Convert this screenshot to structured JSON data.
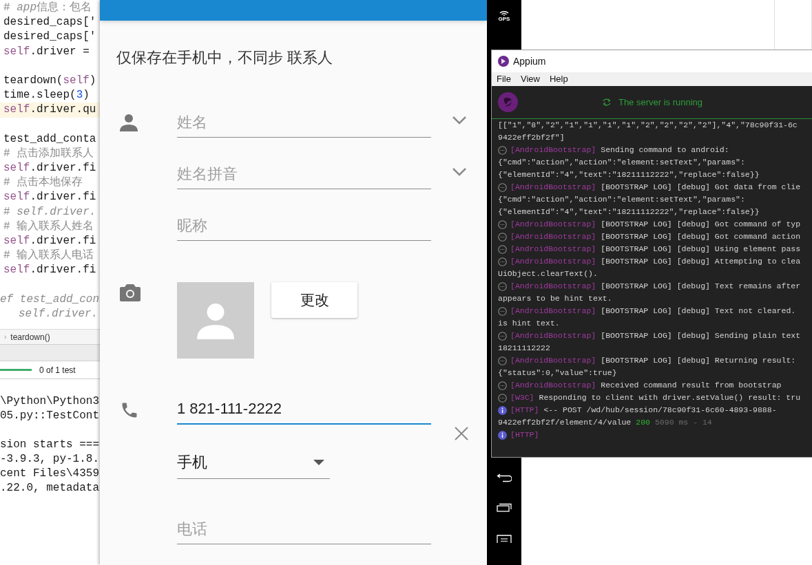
{
  "ide": {
    "code_lines": [
      {
        "kind": "code",
        "current": false,
        "segments": [
          {
            "kind": "comment",
            "text": "# "
          },
          {
            "kind": "comment_italic",
            "text": "app"
          },
          {
            "kind": "comment",
            "text": "信息：包名"
          }
        ]
      },
      {
        "kind": "code",
        "current": false,
        "segments": [
          {
            "kind": "plain",
            "text": "desired_caps['"
          }
        ]
      },
      {
        "kind": "code",
        "current": false,
        "segments": [
          {
            "kind": "plain",
            "text": "desired_caps['"
          }
        ]
      },
      {
        "kind": "code",
        "current": false,
        "segments": [
          {
            "kind": "self",
            "text": "self"
          },
          {
            "kind": "plain",
            "text": ".driver ="
          }
        ]
      },
      {
        "kind": "blank"
      },
      {
        "kind": "code",
        "current": false,
        "segments": [
          {
            "kind": "plain",
            "text": "teardown("
          },
          {
            "kind": "self",
            "text": "self"
          },
          {
            "kind": "plain",
            "text": ")"
          }
        ]
      },
      {
        "kind": "code",
        "current": false,
        "segments": [
          {
            "kind": "plain",
            "text": "time.sleep("
          },
          {
            "kind": "number",
            "text": "3"
          },
          {
            "kind": "plain",
            "text": ")"
          }
        ]
      },
      {
        "kind": "code",
        "current": true,
        "segments": [
          {
            "kind": "self",
            "text": "self"
          },
          {
            "kind": "plain",
            "text": ".driver.qu"
          }
        ]
      },
      {
        "kind": "blank"
      },
      {
        "kind": "code",
        "current": false,
        "segments": [
          {
            "kind": "plain",
            "text": "test_add_conta"
          }
        ]
      },
      {
        "kind": "code",
        "current": false,
        "segments": [
          {
            "kind": "comment",
            "text": "# 点击添加联系人"
          }
        ]
      },
      {
        "kind": "code",
        "current": false,
        "segments": [
          {
            "kind": "self",
            "text": "self"
          },
          {
            "kind": "plain",
            "text": ".driver.fi"
          }
        ]
      },
      {
        "kind": "code",
        "current": false,
        "segments": [
          {
            "kind": "comment",
            "text": "# 点击本地保存"
          }
        ]
      },
      {
        "kind": "code",
        "current": false,
        "segments": [
          {
            "kind": "self",
            "text": "self"
          },
          {
            "kind": "plain",
            "text": ".driver.fi"
          }
        ]
      },
      {
        "kind": "code",
        "current": false,
        "segments": [
          {
            "kind": "comment",
            "text": "# "
          },
          {
            "kind": "comment_italic",
            "text": "self.driver."
          }
        ]
      },
      {
        "kind": "code",
        "current": false,
        "segments": [
          {
            "kind": "comment",
            "text": "# 输入联系人姓名"
          }
        ]
      },
      {
        "kind": "code",
        "current": false,
        "segments": [
          {
            "kind": "self",
            "text": "self"
          },
          {
            "kind": "plain",
            "text": ".driver.fi"
          }
        ]
      },
      {
        "kind": "code",
        "current": false,
        "segments": [
          {
            "kind": "comment",
            "text": "# 输入联系人电话"
          }
        ]
      },
      {
        "kind": "code",
        "current": false,
        "segments": [
          {
            "kind": "self",
            "text": "self"
          },
          {
            "kind": "plain",
            "text": ".driver.fi"
          }
        ]
      },
      {
        "kind": "blank"
      },
      {
        "kind": "edge_code",
        "current": false,
        "segments": [
          {
            "kind": "comment_italic",
            "text": "ef test_add_con"
          }
        ]
      },
      {
        "kind": "indented_code",
        "current": false,
        "segments": [
          {
            "kind": "comment_italic",
            "text": "self.driver."
          }
        ]
      }
    ],
    "breadcrumb": {
      "separator": "›",
      "item": "teardown()"
    },
    "test_progress": {
      "level": 1,
      "label": "0 of 1 test"
    },
    "console_lines": [
      {
        "kind": "text",
        "text": "\\Python\\Python3"
      },
      {
        "kind": "text",
        "text": "05.py::TestCont"
      },
      {
        "kind": "blank"
      },
      {
        "kind": "text",
        "text": "sion starts ==="
      },
      {
        "kind": "text",
        "text": "-3.9.3, py-1.8."
      },
      {
        "kind": "text",
        "text": "cent Files\\4359"
      },
      {
        "kind": "text",
        "text": ".22.0, metadata"
      }
    ]
  },
  "phone": {
    "heading": "仅保存在手机中，不同步 联系人",
    "rows": [
      {
        "kind": "field",
        "placeholder": "姓名",
        "expandable": true
      },
      {
        "kind": "field",
        "placeholder": "姓名拼音",
        "expandable": true
      },
      {
        "kind": "field",
        "placeholder": "昵称",
        "expandable": false
      },
      {
        "kind": "photo",
        "button": "更改"
      },
      {
        "kind": "value",
        "value": "1 821-111-2222",
        "focused": true,
        "removable": true
      },
      {
        "kind": "dropdown",
        "value": "手机"
      },
      {
        "kind": "field",
        "placeholder": "电话",
        "expandable": false
      }
    ]
  },
  "emulator_sidebar": {
    "label": "GPS"
  },
  "appium": {
    "title": "Appium",
    "menu": [
      "File",
      "View",
      "Help"
    ],
    "status": "The server is running",
    "log": [
      {
        "kind": "continuation",
        "text": "[[\"1\",\"8\",\"2\",\"1\",\"1\",\"1\",\"1\",\"2\",\"2\",\"2\",\"2\"],\"4\",\"78c90f31-6c"
      },
      {
        "kind": "continuation",
        "text": "9422eff2bf2f\"]"
      },
      {
        "kind": "debug",
        "tag": "[AndroidBootstrap]",
        "message": "Sending command to android:"
      },
      {
        "kind": "continuation",
        "text": "{\"cmd\":\"action\",\"action\":\"element:setText\",\"params\":"
      },
      {
        "kind": "continuation",
        "text": "{\"elementId\":\"4\",\"text\":\"18211112222\",\"replace\":false}}"
      },
      {
        "kind": "debug",
        "tag": "[AndroidBootstrap]",
        "message": "[BOOTSTRAP LOG] [debug] Got data from clie"
      },
      {
        "kind": "continuation",
        "text": "{\"cmd\":\"action\",\"action\":\"element:setText\",\"params\":"
      },
      {
        "kind": "continuation",
        "text": "{\"elementId\":\"4\",\"text\":\"18211112222\",\"replace\":false}}"
      },
      {
        "kind": "debug",
        "tag": "[AndroidBootstrap]",
        "message": "[BOOTSTRAP LOG] [debug] Got command of typ"
      },
      {
        "kind": "debug",
        "tag": "[AndroidBootstrap]",
        "message": "[BOOTSTRAP LOG] [debug] Got command action"
      },
      {
        "kind": "debug",
        "tag": "[AndroidBootstrap]",
        "message": "[BOOTSTRAP LOG] [debug] Using element pass"
      },
      {
        "kind": "debug",
        "tag": "[AndroidBootstrap]",
        "message": "[BOOTSTRAP LOG] [debug] Attempting to clea"
      },
      {
        "kind": "continuation",
        "text": "UiObject.clearText()."
      },
      {
        "kind": "debug",
        "tag": "[AndroidBootstrap]",
        "message": "[BOOTSTRAP LOG] [debug] Text remains after"
      },
      {
        "kind": "continuation",
        "text": "appears to be hint text."
      },
      {
        "kind": "debug",
        "tag": "[AndroidBootstrap]",
        "message": "[BOOTSTRAP LOG] [debug] Text not cleared."
      },
      {
        "kind": "continuation",
        "text": "is hint text."
      },
      {
        "kind": "debug",
        "tag": "[AndroidBootstrap]",
        "message": "[BOOTSTRAP LOG] [debug] Sending plain text"
      },
      {
        "kind": "continuation",
        "text": "18211112222"
      },
      {
        "kind": "debug",
        "tag": "[AndroidBootstrap]",
        "message": "[BOOTSTRAP LOG] [debug] Returning result:"
      },
      {
        "kind": "continuation",
        "text": "{\"status\":0,\"value\":true}"
      },
      {
        "kind": "debug",
        "tag": "[AndroidBootstrap]",
        "message": "Received command result from bootstrap"
      },
      {
        "kind": "debug",
        "tag": "[W3C]",
        "message": "Responding to client with driver.setValue() result: tru"
      },
      {
        "kind": "info",
        "tag": "[HTTP]",
        "message": "<-- POST /wd/hub/session/78c90f31-6c60-4893-9888-"
      },
      {
        "kind": "continuation",
        "text": "9422eff2bf2f/element/4/value",
        "status": "200",
        "timing": "5090 ms - 14"
      },
      {
        "kind": "info",
        "tag": "[HTTP]"
      }
    ]
  }
}
